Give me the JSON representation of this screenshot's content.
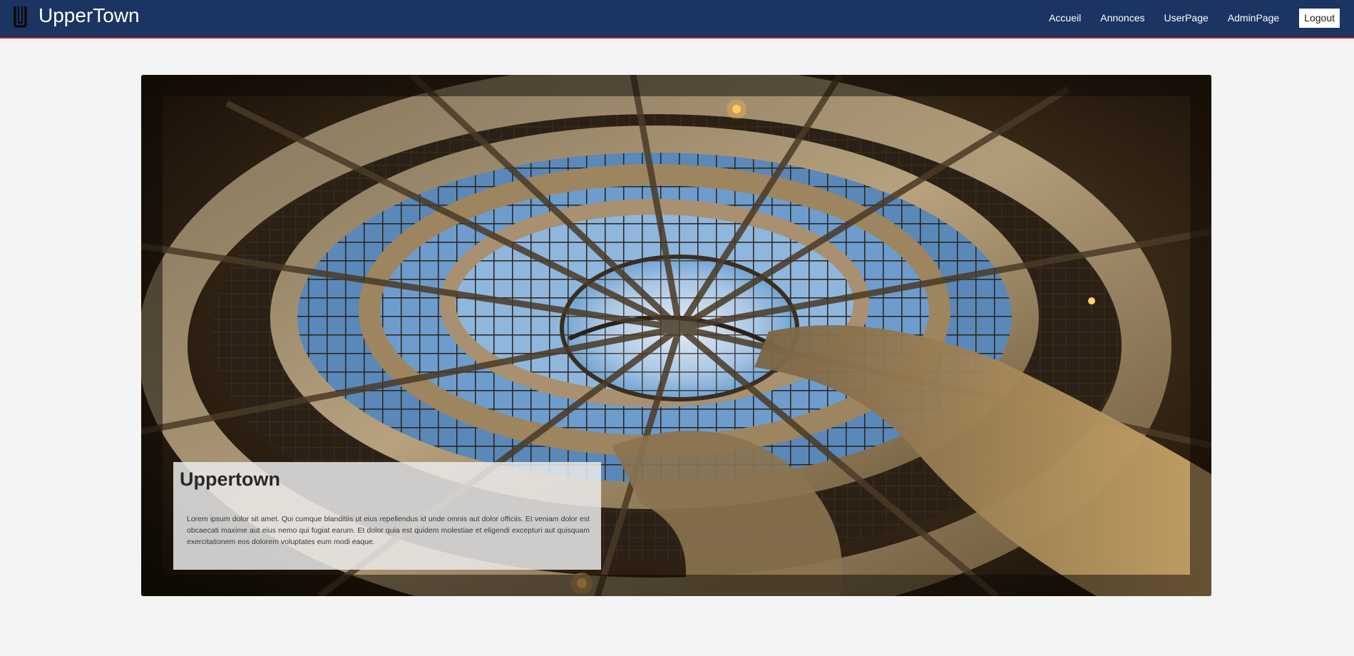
{
  "brand": {
    "logo_icon": "u-letter-logo-icon",
    "name": "UpperTown"
  },
  "nav": {
    "items": [
      {
        "label": "Accueil"
      },
      {
        "label": "Annonces"
      },
      {
        "label": "UserPage"
      },
      {
        "label": "AdminPage"
      }
    ],
    "logout_label": "Logout"
  },
  "hero": {
    "image_icon": "atrium-ceiling-photo",
    "caption": {
      "title": "Uppertown",
      "body": "Lorem ipsum dolor sit amet. Qui cumque blanditiis ut eius repellendus id unde omnis aut dolor officiis. Et veniam dolor est obcaecati maxime aut eius nemo qui fugiat earum. Et dolor quia est quidem molestiae et eligendi excepturi aut quisquam exercitationem eos dolorem voluptates eum modi eaque."
    }
  },
  "colors": {
    "navbar_bg": "#1b3461",
    "navbar_border": "#b3202a",
    "page_bg": "#f4f4f4"
  }
}
